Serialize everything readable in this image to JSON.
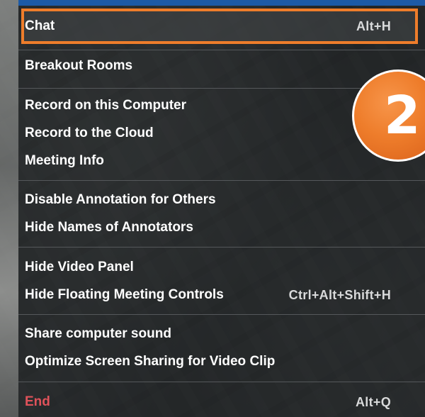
{
  "menu": {
    "items": [
      {
        "label": "Chat",
        "shortcut": "Alt+H"
      },
      {
        "label": "Breakout Rooms",
        "shortcut": ""
      },
      {
        "label": "Record on this Computer",
        "shortcut": ""
      },
      {
        "label": "Record to the Cloud",
        "shortcut": ""
      },
      {
        "label": "Meeting Info",
        "shortcut": ""
      },
      {
        "label": "Disable Annotation for Others",
        "shortcut": ""
      },
      {
        "label": "Hide Names of Annotators",
        "shortcut": ""
      },
      {
        "label": "Hide Video Panel",
        "shortcut": ""
      },
      {
        "label": "Hide Floating Meeting Controls",
        "shortcut": "Ctrl+Alt+Shift+H"
      },
      {
        "label": "Share computer sound",
        "shortcut": ""
      },
      {
        "label": "Optimize Screen Sharing for Video Clip",
        "shortcut": ""
      },
      {
        "label": "End",
        "shortcut": "Alt+Q"
      }
    ]
  },
  "callout": {
    "number": "2"
  },
  "colors": {
    "highlight": "#ee7d2b",
    "badge": "#ee7d2b",
    "end_text": "#e0525a",
    "top_bar": "#1c5aa6"
  }
}
